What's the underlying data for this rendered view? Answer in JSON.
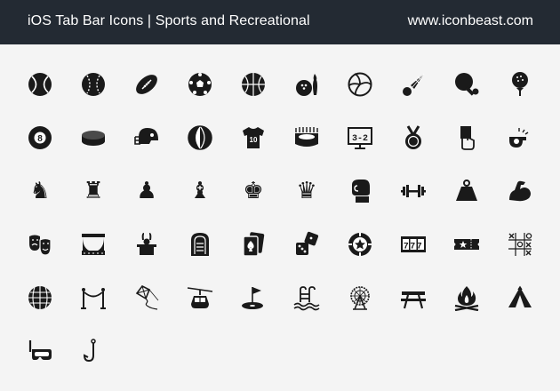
{
  "header": {
    "title": "iOS Tab Bar Icons | Sports and Recreational",
    "site": "www.iconbeast.com"
  },
  "colors": {
    "header_bg": "#232a33",
    "icon": "#1a1a1a",
    "page_bg": "#f4f4f4"
  },
  "icons": [
    [
      "tennis-ball-icon",
      "baseball-icon",
      "football-icon",
      "soccer-ball-icon",
      "basketball-icon",
      "bowling-icon",
      "volleyball-icon",
      "shuttlecock-icon",
      "ping-pong-icon",
      "golf-ball-icon"
    ],
    [
      "billiard-8-ball-icon",
      "hockey-puck-icon",
      "football-helmet-icon",
      "beach-ball-icon",
      "jersey-icon",
      "stadium-icon",
      "scoreboard-icon",
      "medal-icon",
      "referee-card-icon",
      "whistle-icon"
    ],
    [
      "chess-knight-icon",
      "chess-rook-icon",
      "chess-pawn-icon",
      "chess-bishop-icon",
      "chess-king-icon",
      "chess-queen-icon",
      "boxing-glove-icon",
      "dumbbell-icon",
      "weight-icon",
      "flexed-arm-icon"
    ],
    [
      "theater-masks-icon",
      "stage-curtain-icon",
      "magic-hat-icon",
      "jukebox-icon",
      "playing-cards-icon",
      "dice-icon",
      "poker-chip-icon",
      "slot-machine-icon",
      "ticket-icon",
      "tic-tac-toe-icon"
    ],
    [
      "disco-ball-icon",
      "rope-barrier-icon",
      "kite-icon",
      "cable-car-icon",
      "golf-flag-icon",
      "swimming-pool-icon",
      "ferris-wheel-icon",
      "picnic-table-icon",
      "campfire-icon",
      "tent-icon"
    ],
    [
      "snorkel-mask-icon",
      "fishing-hook-icon"
    ]
  ],
  "scoreboard_text": "3-2",
  "jersey_number": "10",
  "slot_text": "777",
  "eight_text": "8"
}
